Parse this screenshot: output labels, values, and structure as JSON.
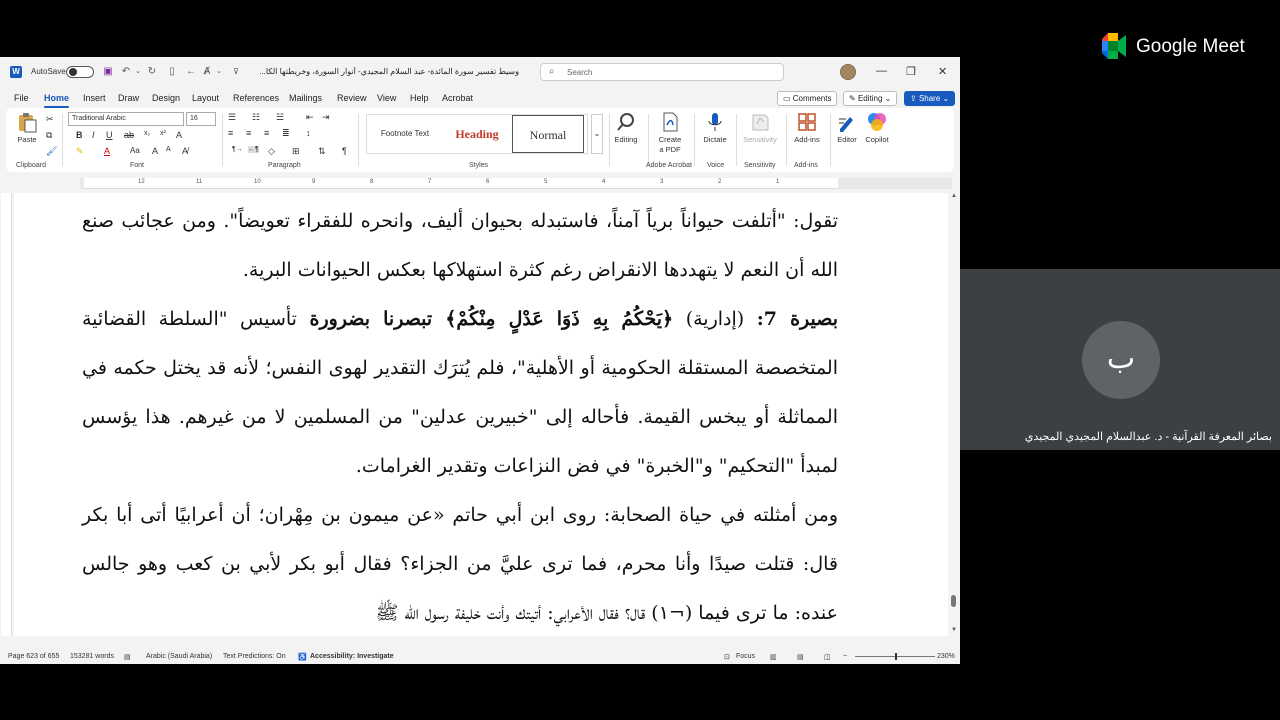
{
  "app": {
    "autosave_label": "AutoSave",
    "doc_title": "وسيط تفسير سورة المائدة- عبد السلام المجيدي- أنوار السورة، وخريطتها الكا...",
    "search_placeholder": "Search",
    "window_controls": [
      "—",
      "❐",
      "✕"
    ]
  },
  "tabs": [
    "File",
    "Home",
    "Insert",
    "Draw",
    "Design",
    "Layout",
    "References",
    "Mailings",
    "Review",
    "View",
    "Help",
    "Acrobat"
  ],
  "top_buttons": {
    "comments": "Comments",
    "editing": "Editing",
    "share": "Share"
  },
  "ribbon": {
    "paste": "Paste",
    "font_name": "Traditional Arabic",
    "font_size": "16",
    "groups": [
      "Clipboard",
      "Font",
      "Paragraph",
      "Styles",
      "Adobe Acrobat",
      "Voice",
      "Sensitivity",
      "Add-ins"
    ],
    "styles": {
      "footnote": "Footnote Text",
      "heading": "Heading",
      "normal": "Normal"
    },
    "buttons": {
      "editing": "Editing",
      "create_pdf_1": "Create",
      "create_pdf_2": "a PDF",
      "dictate": "Dictate",
      "sensitivity": "Sensitivity",
      "addins": "Add-ins",
      "editor": "Editor",
      "copilot": "Copilot"
    }
  },
  "ruler_numbers": [
    "12",
    "11",
    "10",
    "9",
    "8",
    "7",
    "6",
    "5",
    "4",
    "3",
    "2",
    "1"
  ],
  "document": {
    "p1": "تقول: \"أتلفت حيواناً برياً آمناً، فاستبدله بحيوان أليف، وانحره للفقراء تعويضاً\". ومن عجائب صنع الله أن النعم لا يتهددها الانقراض رغم كثرة استهلاكها بعكس الحيوانات البرية.",
    "p2_bold_lead": "بصيرة 7:",
    "p2_label": " (إدارية) ",
    "p2_verse": "﴿يَحْكُمُ بِهِ ذَوَا عَدْلٍ مِنْكُمْ﴾",
    "p2_bold_mid": " تبصرنا بضرورة",
    "p2_rest": " تأسيس \"السلطة القضائية المتخصصة المستقلة الحكومية أو الأهلية\"، فلم يُترَك التقدير لهوى النفس؛ لأنه قد يختل حكمه في المماثلة أو يبخس القيمة. فأحاله إلى \"خبيرين عدلين\" من المسلمين لا من غيرهم. هذا يؤسس لمبدأ \"التحكيم\" و\"الخبرة\" في فض النزاعات وتقدير الغرامات.",
    "p3": "ومن أمثلته في حياة الصحابة: روى ابن أبي حاتم «عن ميمون بن مِهْران؛ أن أعرابيًا أتى أبا بكر قال: قتلت صيدًا وأنا محرم، فما ترى عليَّ من الجزاء؟ فقال أبو بكر لأبي بن كعب وهو جالس عنده: ما ترى فيما (¬١) قال؟ فقال الأعرابي: أتيتك وأنت خليفة رسول الله ﷺ"
  },
  "status": {
    "page": "Page 623 of 655",
    "words": "153281 words",
    "language": "Arabic (Saudi Arabia)",
    "predictions": "Text Predictions: On",
    "accessibility": "Accessibility: Investigate",
    "focus": "Focus",
    "zoom": "230%"
  },
  "meet": {
    "brand": "Google Meet",
    "participant_initial": "ب",
    "participant_name": "بصائر المعرفة القرآنية - د. عبدالسلام المجيدي المجيدي"
  },
  "colors": {
    "word_blue": "#185abd",
    "tile_bg": "#3c4043",
    "avatar_bg": "#5f6368"
  }
}
